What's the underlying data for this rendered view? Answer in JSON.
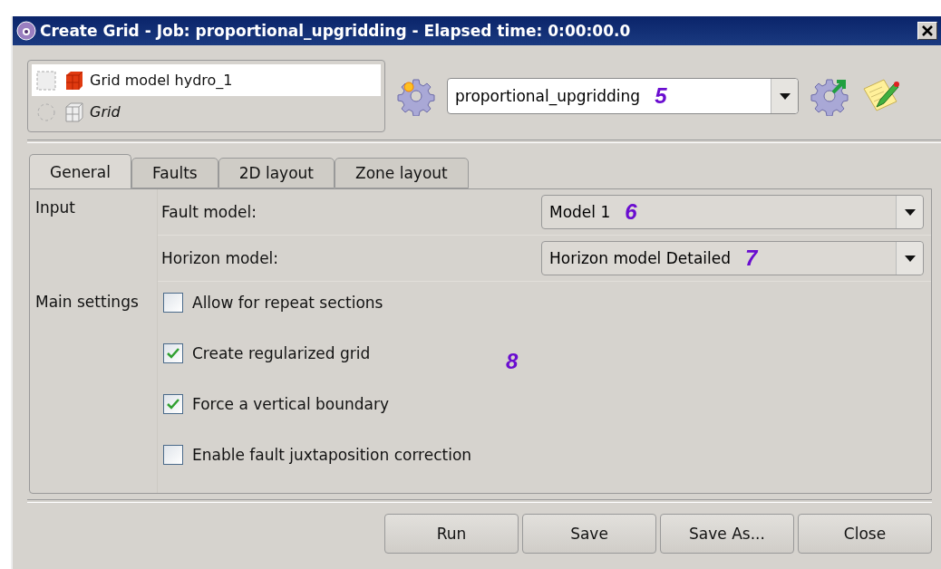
{
  "window": {
    "title": "Create Grid - Job: proportional_upgridding - Elapsed time: 0:00:00.0"
  },
  "objects": [
    {
      "label": "Grid model hydro_1",
      "kind": "model"
    },
    {
      "label": "Grid",
      "kind": "type"
    }
  ],
  "job": {
    "value": "proportional_upgridding",
    "callout": "5"
  },
  "tabs": [
    {
      "label": "General",
      "selected": true
    },
    {
      "label": "Faults",
      "selected": false
    },
    {
      "label": "2D layout",
      "selected": false
    },
    {
      "label": "Zone layout",
      "selected": false
    }
  ],
  "input": {
    "heading": "Input",
    "fields": [
      {
        "label": "Fault model:",
        "value": "Model 1",
        "callout": "6"
      },
      {
        "label": "Horizon model:",
        "value": "Horizon model Detailed",
        "callout": "7"
      }
    ]
  },
  "main_settings": {
    "heading": "Main settings",
    "callout": "8",
    "options": [
      {
        "label": "Allow for repeat sections",
        "checked": false
      },
      {
        "label": "Create regularized grid",
        "checked": true
      },
      {
        "label": "Force a vertical boundary",
        "checked": true
      },
      {
        "label": "Enable fault juxtaposition correction",
        "checked": false
      }
    ]
  },
  "buttons": [
    "Run",
    "Save",
    "Save As...",
    "Close"
  ]
}
